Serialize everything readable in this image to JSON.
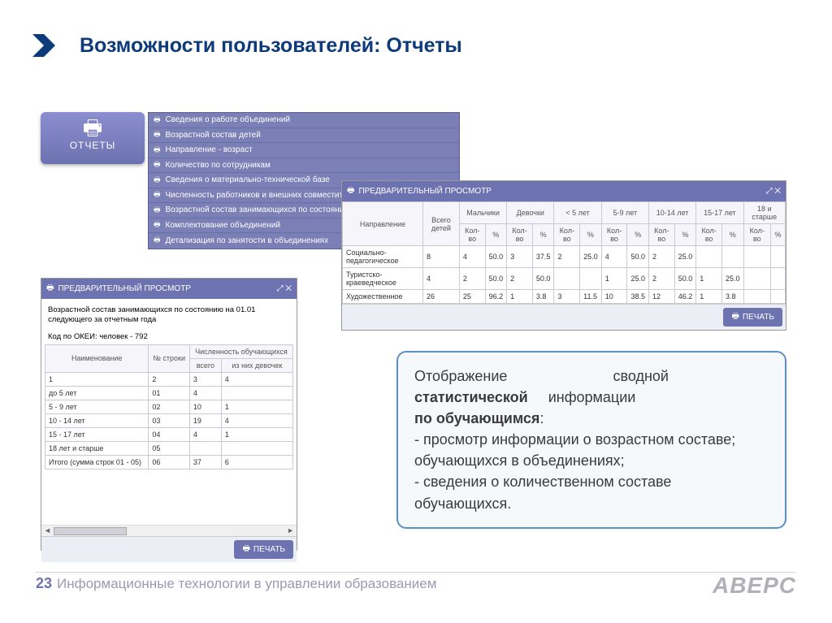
{
  "title": "Возможности пользователей: Отчеты",
  "reports_button_label": "ОТЧЕТЫ",
  "menu_items": [
    "Сведения о работе объединений",
    "Возрастной состав детей",
    "Направление - возраст",
    "Количество по сотрудникам",
    "Сведения о материально-технической базе",
    "Численность работников и внешних совместителей",
    "Возрастной состав занимающихся по состоянию",
    "Комплектование объединений",
    "Детализация по занятости в объединениях"
  ],
  "preview_window_title": "ПРЕДВАРИТЕЛЬНЫЙ ПРОСМОТР",
  "print_label": "ПЕЧАТЬ",
  "wide_table": {
    "headers_top": [
      "Направление",
      "Всего детей",
      "Мальчики",
      "Девочки",
      "< 5 лет",
      "5-9 лет",
      "10-14 лет",
      "15-17 лет",
      "18 и старше"
    ],
    "headers_sub": [
      "Кол-во",
      "%"
    ],
    "rows": [
      {
        "name": "Социально-педагогическое",
        "total": "8",
        "cells": [
          "4",
          "50.0",
          "3",
          "37.5",
          "2",
          "25.0",
          "4",
          "50.0",
          "2",
          "25.0",
          "",
          "",
          "",
          ""
        ]
      },
      {
        "name": "Туристско-краеведческое",
        "total": "4",
        "cells": [
          "2",
          "50.0",
          "2",
          "50.0",
          "",
          "",
          "1",
          "25.0",
          "2",
          "50.0",
          "1",
          "25.0",
          "",
          ""
        ]
      },
      {
        "name": "Художественное",
        "total": "26",
        "cells": [
          "25",
          "96.2",
          "1",
          "3.8",
          "3",
          "11.5",
          "10",
          "38.5",
          "12",
          "46.2",
          "1",
          "3.8",
          "",
          ""
        ]
      }
    ]
  },
  "narrow": {
    "desc": "Возрастной состав занимающихся по состоянию на 01.01 следующего за отчетным года",
    "okei": "Код по ОКЕИ: человек - 792",
    "headers": [
      "Наименование",
      "№ строки",
      "всего",
      "из них девочек"
    ],
    "header_group": "Численность обучающихся",
    "rows": [
      [
        "1",
        "2",
        "3",
        "4"
      ],
      [
        "до 5 лет",
        "01",
        "4",
        ""
      ],
      [
        "5 - 9 лет",
        "02",
        "10",
        "1"
      ],
      [
        "10 - 14 лет",
        "03",
        "19",
        "4"
      ],
      [
        "15 - 17 лет",
        "04",
        "4",
        "1"
      ],
      [
        "18 лет и старше",
        "05",
        "",
        ""
      ],
      [
        "Итого (сумма строк 01 - 05)",
        "06",
        "37",
        "6"
      ]
    ]
  },
  "callout": {
    "line1a": "Отображение",
    "line1b": "сводной",
    "line2": "статистической",
    "line2b": "информации",
    "line3": "по обучающимся",
    "bullet1": "- просмотр информации о возрастном составе; обучающихся в объединениях;",
    "bullet2": "- сведения о количественном составе обучающихся."
  },
  "page_number": "23",
  "footer": "Информационные технологии в управлении образованием",
  "brand": "АВЕРС"
}
